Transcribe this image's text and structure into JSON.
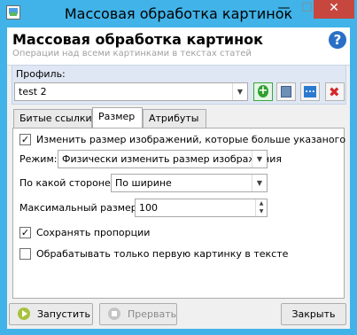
{
  "window": {
    "title": "Массовая обработка картинок",
    "controls": {
      "minimize": "—",
      "maximize": "☐",
      "close": "✕"
    }
  },
  "header": {
    "title": "Массовая обработка картинок",
    "subtitle": "Операции над всеми картинками в текстах статей",
    "help_icon": "?"
  },
  "profile": {
    "label": "Профиль:",
    "value": "test 2",
    "buttons": {
      "add": "+",
      "save": "save-icon",
      "more": "...",
      "delete": "✖"
    }
  },
  "tabs": [
    {
      "label": "Битые ссылки",
      "active": false
    },
    {
      "label": "Размер",
      "active": true
    },
    {
      "label": "Атрибуты",
      "active": false
    }
  ],
  "size_tab": {
    "resize_checkbox": {
      "label": "Изменить размер изображений, которые больше указаного",
      "checked": true
    },
    "mode": {
      "label": "Режим:",
      "value": "Физически изменить размер изображения"
    },
    "side": {
      "label": "По какой стороне:",
      "value": "По ширине"
    },
    "max_size": {
      "label": "Максимальный размер:",
      "value": "100"
    },
    "keep_proportions": {
      "label": "Сохранять пропорции",
      "checked": true
    },
    "first_only": {
      "label": "Обрабатывать только первую картинку в тексте",
      "checked": false
    }
  },
  "footer": {
    "run_label": "Запустить",
    "stop_label": "Прервать",
    "close_label": "Закрыть"
  },
  "colors": {
    "title_bar": "#41b3e8",
    "close_button": "#c7463d",
    "profile_panel": "#dfe7f4"
  }
}
